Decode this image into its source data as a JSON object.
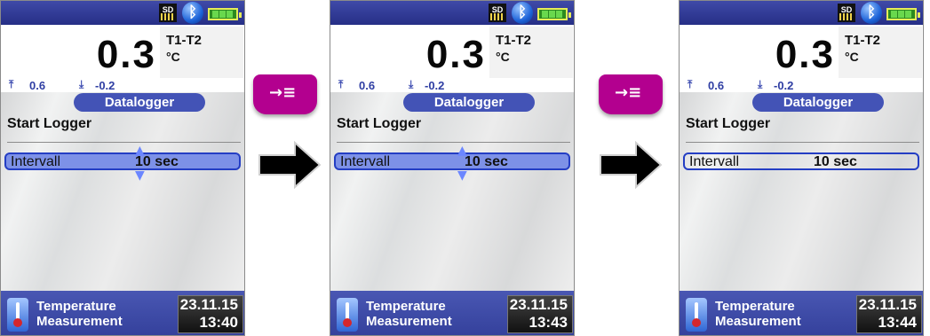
{
  "common": {
    "sd_label": "SD",
    "main_value": "0.3",
    "unit_title": "T1-T2",
    "unit_label": "°C",
    "max_value": "0.6",
    "min_value": "-0.2",
    "menu_title": "Datalogger",
    "list_title": "Start Logger",
    "setting_label": "Intervall",
    "setting_value": "10 sec",
    "footer_line1": "Temperature",
    "footer_line2": "Measurement",
    "date": "23.11.15",
    "icons": [
      "sd-card-icon",
      "bluetooth-icon",
      "battery-icon",
      "max-icon",
      "min-icon",
      "thermometer-icon",
      "arrow-right-icon",
      "log-key-icon"
    ]
  },
  "screens": [
    {
      "time": "13:40",
      "state": "selected"
    },
    {
      "time": "13:43",
      "state": "selected"
    },
    {
      "time": "13:44",
      "state": "outlined"
    }
  ],
  "colors": {
    "status_bar": "#2d3790",
    "accent": "#4353b6",
    "selection": "#7d91e7",
    "key": "#b3008f"
  },
  "key_label": "→≡"
}
